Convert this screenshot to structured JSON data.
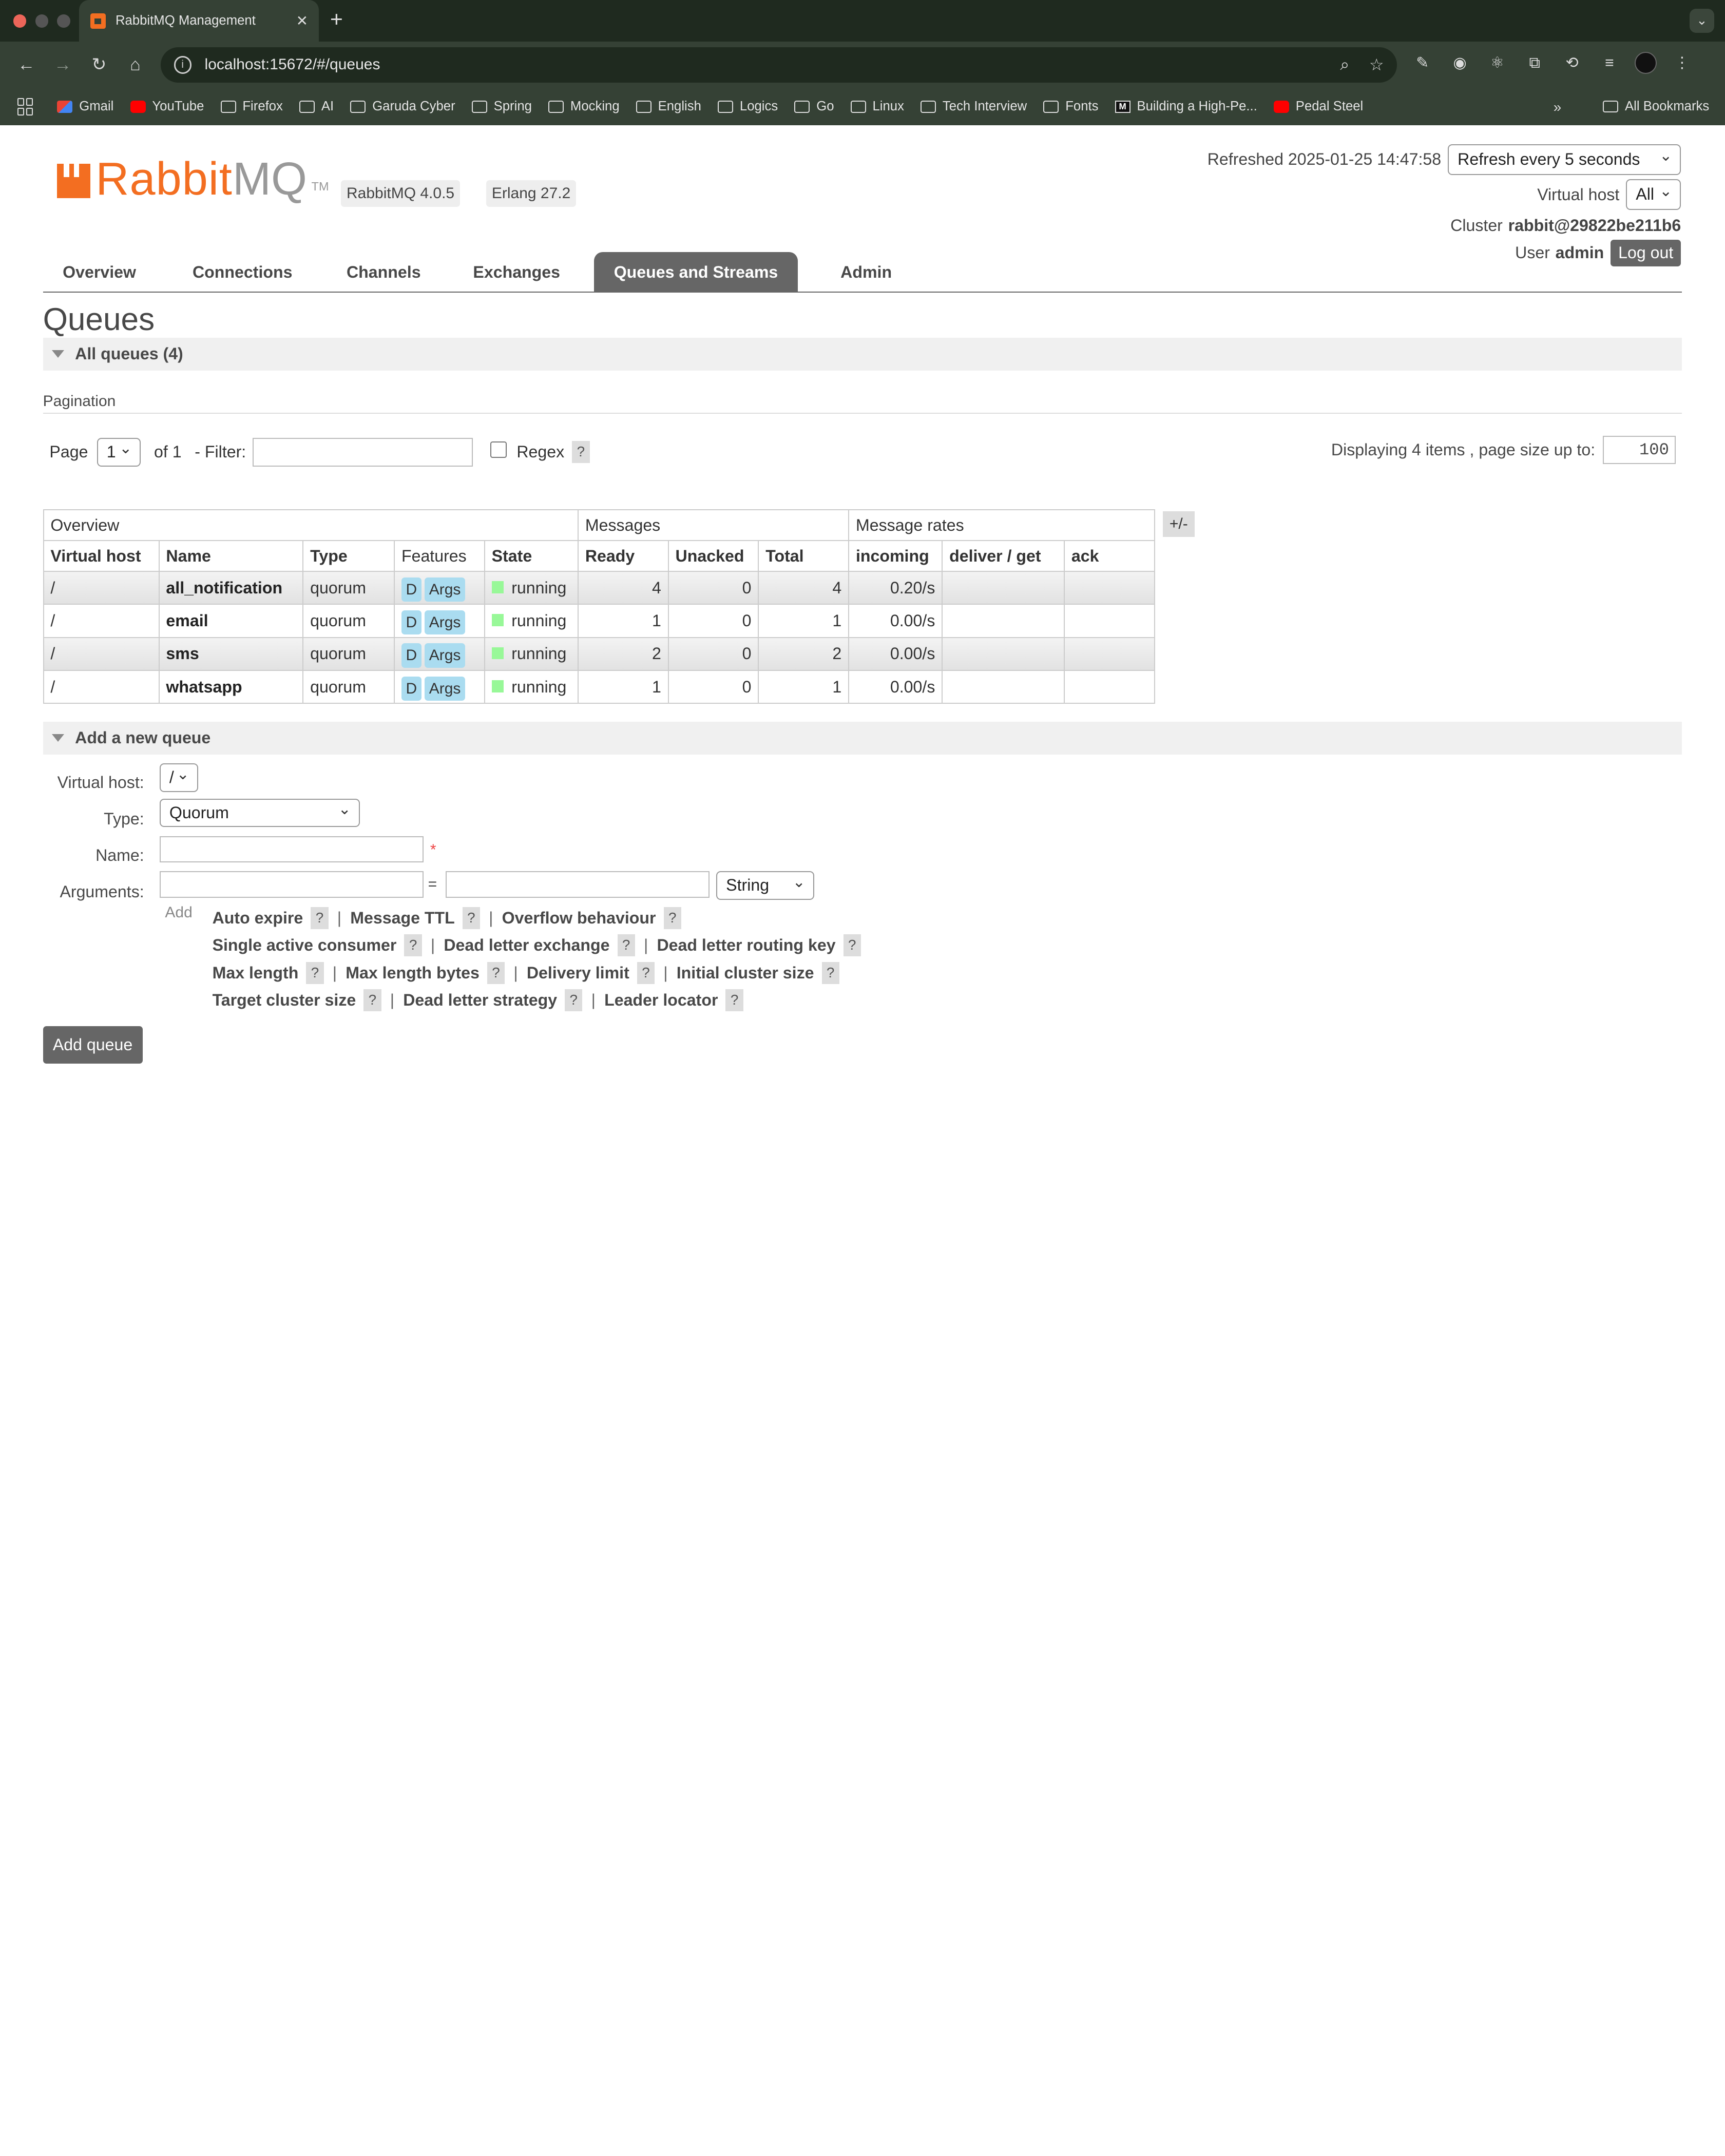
{
  "browser": {
    "tab_title": "RabbitMQ Management",
    "url": "localhost:15672/#/queues",
    "bookmarks": [
      {
        "label": "Gmail",
        "icon": "gmail-icon"
      },
      {
        "label": "YouTube",
        "icon": "youtube-icon"
      },
      {
        "label": "Firefox",
        "icon": "folder-icon"
      },
      {
        "label": "AI",
        "icon": "folder-icon"
      },
      {
        "label": "Garuda Cyber",
        "icon": "folder-icon"
      },
      {
        "label": "Spring",
        "icon": "folder-icon"
      },
      {
        "label": "Mocking",
        "icon": "folder-icon"
      },
      {
        "label": "English",
        "icon": "folder-icon"
      },
      {
        "label": "Logics",
        "icon": "folder-icon"
      },
      {
        "label": "Go",
        "icon": "folder-icon"
      },
      {
        "label": "Linux",
        "icon": "folder-icon"
      },
      {
        "label": "Tech Interview",
        "icon": "folder-icon"
      },
      {
        "label": "Fonts",
        "icon": "folder-icon"
      },
      {
        "label": "Building a High-Pe...",
        "icon": "medium-icon"
      },
      {
        "label": "Pedal Steel",
        "icon": "youtube-icon"
      }
    ],
    "all_bookmarks": "All Bookmarks"
  },
  "header": {
    "logo_rabbit": "Rabbit",
    "logo_mq": "MQ",
    "logo_tm": "TM",
    "rabbitmq_version": "RabbitMQ 4.0.5",
    "erlang_version": "Erlang 27.2",
    "refreshed": "Refreshed 2025-01-25 14:47:58",
    "refresh_select": "Refresh every 5 seconds",
    "vhost_label": "Virtual host",
    "vhost_select": "All",
    "cluster_label": "Cluster",
    "cluster_name": "rabbit@29822be211b6",
    "user_label": "User",
    "user_name": "admin",
    "logout": "Log out"
  },
  "nav": {
    "items": [
      "Overview",
      "Connections",
      "Channels",
      "Exchanges",
      "Queues and Streams",
      "Admin"
    ],
    "active": "Queues and Streams"
  },
  "page": {
    "title": "Queues",
    "all_queues": "All queues (4)"
  },
  "pagination": {
    "label": "Pagination",
    "page_label": "Page",
    "page_value": "1",
    "of_label": "of 1",
    "filter_label": "- Filter:",
    "filter_value": "",
    "regex_label": "Regex",
    "help": "?",
    "displaying": "Displaying 4 items , page size up to:",
    "page_size": "100"
  },
  "table": {
    "groups": [
      "Overview",
      "Messages",
      "Message rates"
    ],
    "toggle": "+/-",
    "columns": [
      "Virtual host",
      "Name",
      "Type",
      "Features",
      "State",
      "Ready",
      "Unacked",
      "Total",
      "incoming",
      "deliver / get",
      "ack"
    ],
    "rows": [
      {
        "vhost": "/",
        "name": "all_notification",
        "type": "quorum",
        "feat_d": "D",
        "feat_args": "Args",
        "state": "running",
        "ready": "4",
        "unacked": "0",
        "total": "4",
        "incoming": "0.20/s",
        "deliver_get": "",
        "ack": ""
      },
      {
        "vhost": "/",
        "name": "email",
        "type": "quorum",
        "feat_d": "D",
        "feat_args": "Args",
        "state": "running",
        "ready": "1",
        "unacked": "0",
        "total": "1",
        "incoming": "0.00/s",
        "deliver_get": "",
        "ack": ""
      },
      {
        "vhost": "/",
        "name": "sms",
        "type": "quorum",
        "feat_d": "D",
        "feat_args": "Args",
        "state": "running",
        "ready": "2",
        "unacked": "0",
        "total": "2",
        "incoming": "0.00/s",
        "deliver_get": "",
        "ack": ""
      },
      {
        "vhost": "/",
        "name": "whatsapp",
        "type": "quorum",
        "feat_d": "D",
        "feat_args": "Args",
        "state": "running",
        "ready": "1",
        "unacked": "0",
        "total": "1",
        "incoming": "0.00/s",
        "deliver_get": "",
        "ack": ""
      }
    ]
  },
  "add_queue": {
    "section_title": "Add a new queue",
    "vhost_label": "Virtual host:",
    "vhost_value": "/",
    "type_label": "Type:",
    "type_value": "Quorum",
    "name_label": "Name:",
    "name_value": "",
    "required_mark": "*",
    "arguments_label": "Arguments:",
    "arg_key": "",
    "arg_equals": "=",
    "arg_value": "",
    "arg_type": "String",
    "add_label": "Add",
    "helper_lines": [
      [
        "Auto expire",
        "Message TTL",
        "Overflow behaviour"
      ],
      [
        "Single active consumer",
        "Dead letter exchange",
        "Dead letter routing key"
      ],
      [
        "Max length",
        "Max length bytes",
        "Delivery limit",
        "Initial cluster size"
      ],
      [
        "Target cluster size",
        "Dead letter strategy",
        "Leader locator"
      ]
    ],
    "submit": "Add queue"
  },
  "colors": {
    "brand_orange": "#f36e21",
    "nav_active": "#666666",
    "feature_badge": "#aadcf0",
    "state_running": "#98f898"
  }
}
